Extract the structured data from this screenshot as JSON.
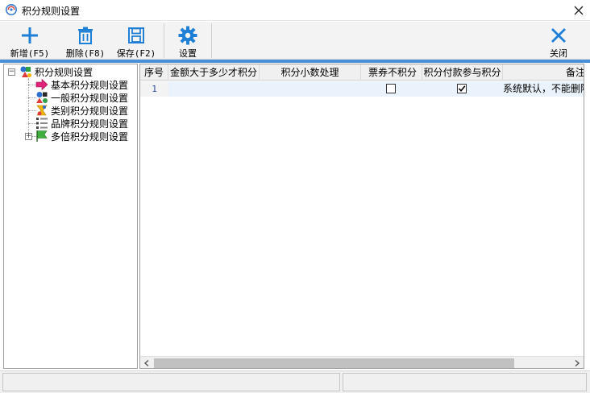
{
  "window": {
    "title": "积分规则设置"
  },
  "toolbar": {
    "buttons": [
      {
        "label": "新增(F5)",
        "icon": "plus-icon"
      },
      {
        "label": "删除(F8)",
        "icon": "trash-icon"
      },
      {
        "label": "保存(F2)",
        "icon": "save-icon"
      },
      {
        "label": "设置",
        "icon": "gear-icon"
      },
      {
        "label": "关闭",
        "icon": "close-icon"
      }
    ]
  },
  "tree": {
    "root": {
      "label": "积分规则设置",
      "expanded": true
    },
    "children": [
      {
        "label": "基本积分规则设置",
        "icon": "arrow-right-icon"
      },
      {
        "label": "一般积分规则设置",
        "icon": "shapes-icon"
      },
      {
        "label": "类别积分规则设置",
        "icon": "category-icon"
      },
      {
        "label": "品牌积分规则设置",
        "icon": "brand-icon"
      },
      {
        "label": "多倍积分规则设置",
        "icon": "flag-icon",
        "collapsed": true
      }
    ]
  },
  "grid": {
    "columns": [
      "序号",
      "金额大于多少才积分",
      "积分小数处理",
      "票券不积分",
      "积分付款参与积分",
      "备注"
    ],
    "rows": [
      {
        "index": "1",
        "amount": "",
        "decimal": "",
        "coupon_no_points": false,
        "payment_points": true,
        "remark": "系统默认，不能删除"
      }
    ]
  },
  "colors": {
    "accent": "#4a90d9",
    "icon_blue": "#1e7fd6",
    "row_highlight": "#eaf2fb"
  }
}
